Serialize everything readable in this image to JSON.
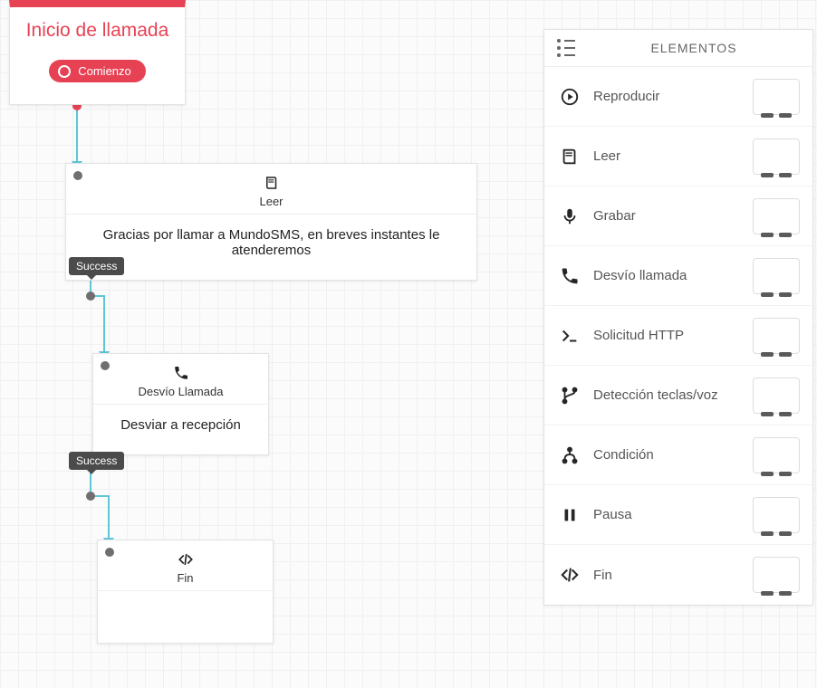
{
  "start": {
    "title": "Inicio de llamada",
    "pill_label": "Comienzo"
  },
  "nodes": {
    "leer": {
      "type_label": "Leer",
      "content": "Gracias por llamar a MundoSMS, en breves instantes le atenderemos"
    },
    "desvio": {
      "type_label": "Desvío Llamada",
      "content": "Desviar a recepción"
    },
    "fin": {
      "type_label": "Fin",
      "content": ""
    }
  },
  "tags": {
    "success1": "Success",
    "success2": "Success"
  },
  "sidebar": {
    "title": "ELEMENTOS",
    "items": [
      {
        "label": "Reproducir",
        "icon": "play"
      },
      {
        "label": "Leer",
        "icon": "book"
      },
      {
        "label": "Grabar",
        "icon": "mic"
      },
      {
        "label": "Desvío llamada",
        "icon": "phone"
      },
      {
        "label": "Solicitud HTTP",
        "icon": "http"
      },
      {
        "label": "Detección teclas/voz",
        "icon": "branch"
      },
      {
        "label": "Condición",
        "icon": "condition"
      },
      {
        "label": "Pausa",
        "icon": "pause"
      },
      {
        "label": "Fin",
        "icon": "code"
      }
    ]
  }
}
